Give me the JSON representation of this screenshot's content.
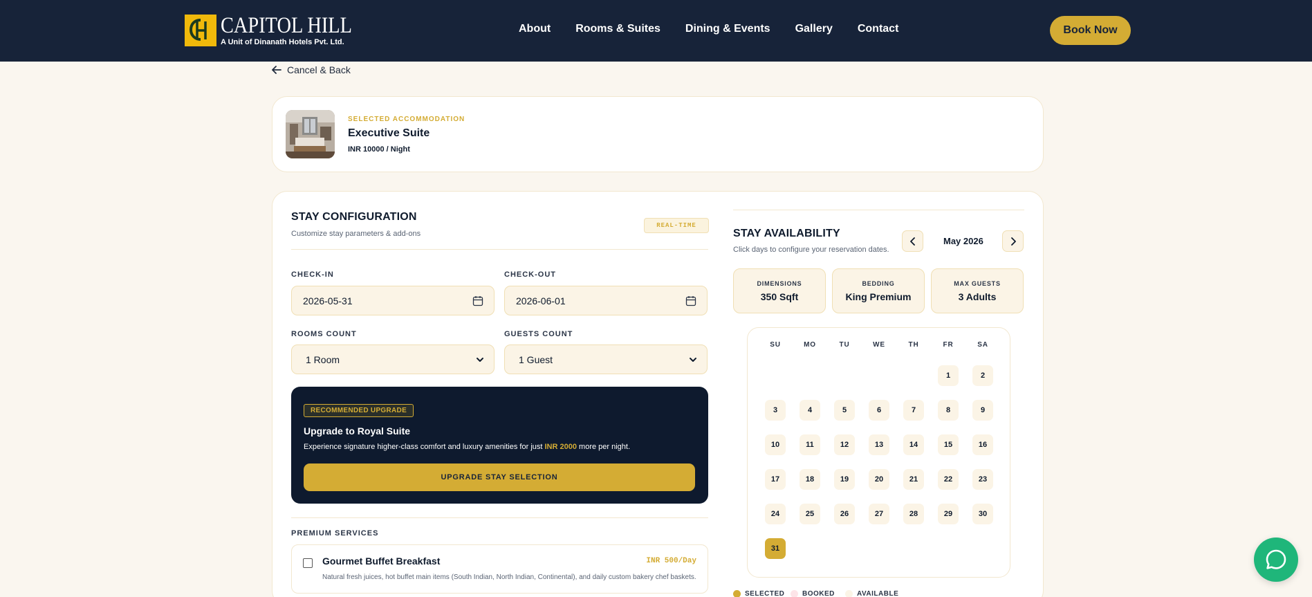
{
  "brand": {
    "name": "CAPITOL HILL",
    "subtitle": "A Unit of Dinanath Hotels Pvt. Ltd.",
    "colors": {
      "navy": "#172339",
      "gold": "#d4ac34",
      "cream": "#faf6ef"
    }
  },
  "nav": {
    "items": [
      "About",
      "Rooms & Suites",
      "Dining & Events",
      "Gallery",
      "Contact"
    ],
    "book_label": "Book Now"
  },
  "back_label": "Cancel & Back",
  "accommodation": {
    "eyebrow": "SELECTED ACCOMMODATION",
    "name": "Executive Suite",
    "price": "INR 10000 / Night"
  },
  "config": {
    "title": "STAY CONFIGURATION",
    "subtitle": "Customize stay parameters & add-ons",
    "badge": "REAL-TIME",
    "checkin_label": "CHECK-IN",
    "checkin_value": "2026-05-31",
    "checkout_label": "CHECK-OUT",
    "checkout_value": "2026-06-01",
    "rooms_label": "ROOMS COUNT",
    "rooms_value": "1 Room",
    "guests_label": "GUESTS COUNT",
    "guests_value": "1 Guest"
  },
  "upgrade": {
    "badge": "RECOMMENDED UPGRADE",
    "title": "Upgrade to Royal Suite",
    "desc_before": "Experience signature higher-class comfort and luxury amenities for just ",
    "desc_highlight": "INR 2000",
    "desc_after": " more per night.",
    "button": "UPGRADE STAY SELECTION"
  },
  "services": {
    "title": "PREMIUM SERVICES",
    "items": [
      {
        "name": "Gourmet Buffet Breakfast",
        "price": "INR 500/Day",
        "desc": "Natural fresh juices, hot buffet main items (South Indian, North Indian, Continental), and daily custom bakery chef baskets.",
        "checked": false
      }
    ]
  },
  "availability": {
    "title": "STAY AVAILABILITY",
    "subtitle": "Click days to configure your reservation dates.",
    "month": "May 2026",
    "specs": [
      {
        "label": "DIMENSIONS",
        "value": "350 Sqft"
      },
      {
        "label": "BEDDING",
        "value": "King Premium"
      },
      {
        "label": "MAX GUESTS",
        "value": "3 Adults"
      }
    ],
    "weekdays": [
      "SU",
      "MO",
      "TU",
      "WE",
      "TH",
      "FR",
      "SA"
    ],
    "first_weekday_index": 5,
    "days_in_month": 31,
    "selected_day": 31,
    "legend": [
      {
        "label": "SELECTED",
        "color": "#d4ac34"
      },
      {
        "label": "BOOKED",
        "color": "#fde4e8"
      },
      {
        "label": "AVAILABLE",
        "color": "#fbf4e6"
      }
    ]
  },
  "icons": {
    "logo": "capitol-hill-logo-icon",
    "back": "arrow-left-icon",
    "calendar": "calendar-icon",
    "chevron": "chevron-down-icon",
    "prev": "chevron-left-icon",
    "next": "chevron-right-icon",
    "chat": "whatsapp-icon"
  }
}
